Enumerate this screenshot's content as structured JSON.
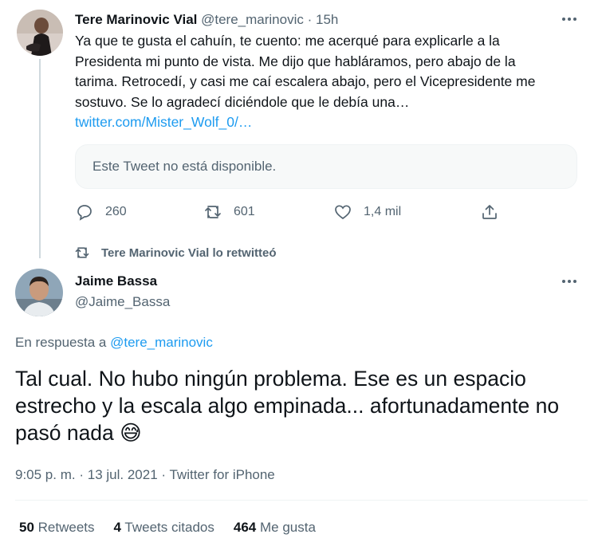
{
  "colors": {
    "accent": "#1d9bf0",
    "muted": "#536471",
    "text": "#0f1419",
    "border": "#cfd9de"
  },
  "tweet1": {
    "name": "Tere Marinovic Vial",
    "handle": "@tere_marinovic",
    "time": "15h",
    "text": "Ya que te gusta el cahuín, te cuento: me acerqué para explicarle  a la Presidenta mi punto de vista. Me dijo que habláramos, pero abajo de la tarima. Retrocedí, y casi me caí escalera abajo, pero el Vicepresidente me sostuvo. Se lo agradecí diciéndole que le debía una…",
    "link": "twitter.com/Mister_Wolf_0/…",
    "quote_unavailable": "Este Tweet no está disponible.",
    "replies": "260",
    "retweets": "601",
    "likes": "1,4 mil",
    "icons": [
      "reply-icon",
      "retweet-icon",
      "like-icon",
      "share-icon",
      "more-icon"
    ]
  },
  "retweet_notice": {
    "text": "Tere Marinovic Vial lo retwitteó",
    "icon": "retweet-icon"
  },
  "tweet2": {
    "name": "Jaime Bassa",
    "handle": "@Jaime_Bassa",
    "reply_prefix": "En respuesta a",
    "reply_to": "@tere_marinovic",
    "text": "Tal cual. No hubo ningún problema. Ese es un espacio estrecho y la escala algo empinada... afortunadamente no pasó nada",
    "emoji": "😅",
    "time": "9:05 p. m.",
    "date": "13 jul. 2021",
    "sep": "·",
    "source": "Twitter for iPhone",
    "stats": {
      "retweets_count": "50",
      "retweets_label": "Retweets",
      "quotes_count": "4",
      "quotes_label": "Tweets citados",
      "likes_count": "464",
      "likes_label": "Me gusta"
    }
  }
}
